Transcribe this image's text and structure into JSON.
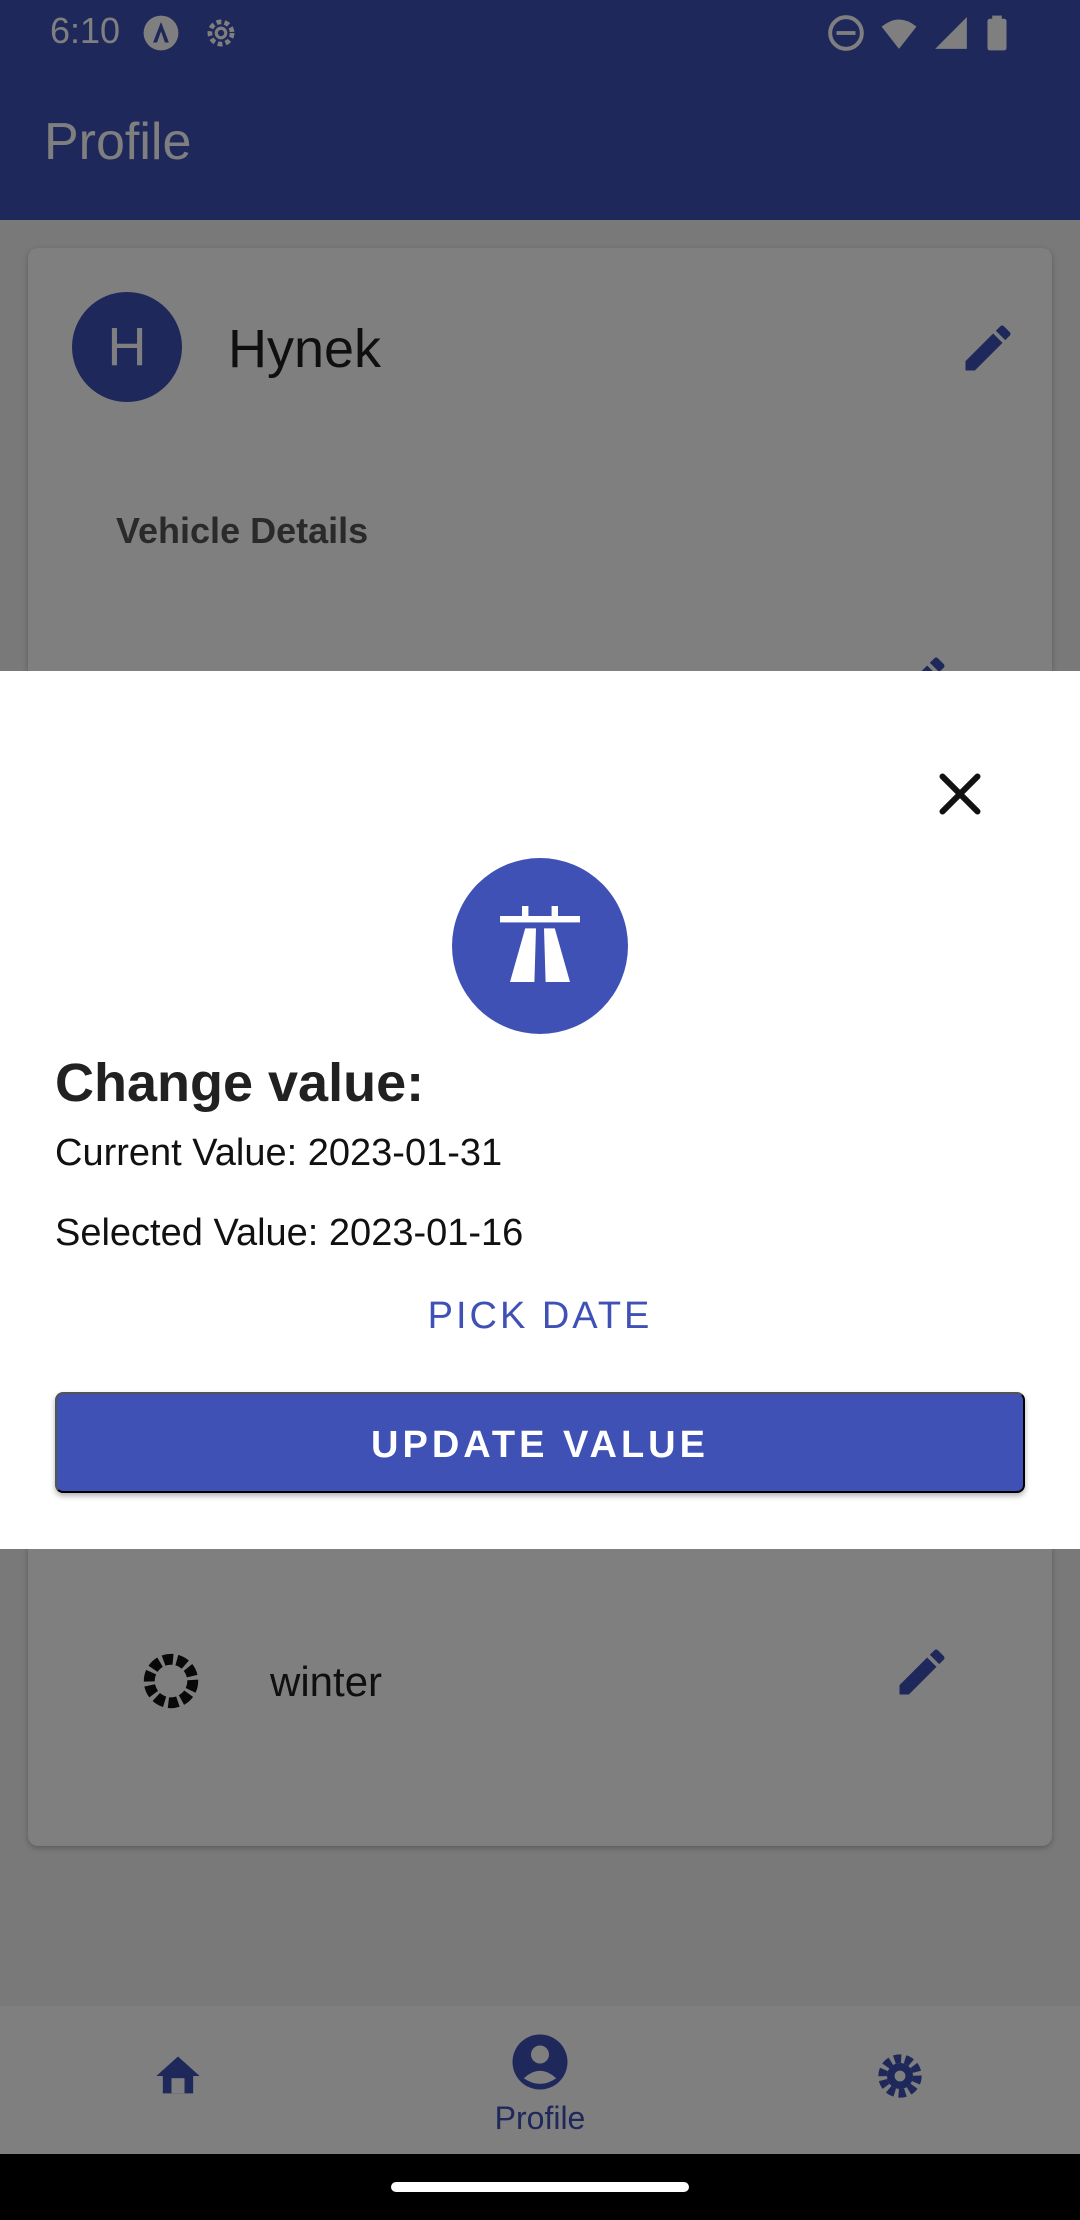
{
  "status_bar": {
    "time": "6:10",
    "icons": [
      "accessibility-icon",
      "settings-icon",
      "do-not-disturb-icon",
      "wifi-icon",
      "signal-icon",
      "battery-icon"
    ]
  },
  "app_bar": {
    "title": "Profile"
  },
  "profile": {
    "avatar_initial": "H",
    "name": "Hynek",
    "section_title": "Vehicle Details",
    "tire_type": "winter"
  },
  "dialog": {
    "icon": "highway-icon",
    "heading": "Change value:",
    "current_value_text": "Current Value: 2023-01-31",
    "selected_value_text": "Selected Value: 2023-01-16",
    "pick_date_label": "PICK DATE",
    "update_label": "UPDATE VALUE"
  },
  "bottom_nav": {
    "items": [
      {
        "icon": "home-icon",
        "label": ""
      },
      {
        "icon": "account-icon",
        "label": "Profile"
      },
      {
        "icon": "settings-icon",
        "label": ""
      }
    ]
  },
  "colors": {
    "primary": "#3f51b5",
    "scrim": "rgba(0,0,0,0.5)"
  }
}
